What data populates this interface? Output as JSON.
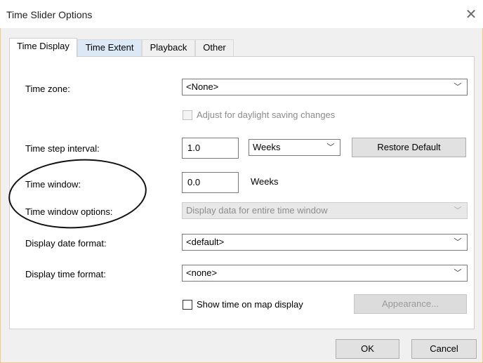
{
  "window": {
    "title": "Time Slider Options"
  },
  "tabs": [
    {
      "label": "Time Display"
    },
    {
      "label": "Time Extent"
    },
    {
      "label": "Playback"
    },
    {
      "label": "Other"
    }
  ],
  "form": {
    "time_zone": {
      "label": "Time zone:",
      "value": "<None>"
    },
    "daylight_saving": {
      "label": "Adjust for daylight saving changes",
      "checked": false,
      "enabled": false
    },
    "time_step_interval": {
      "label": "Time step interval:",
      "value": "1.0",
      "unit": "Weeks",
      "restore_label": "Restore Default"
    },
    "time_window": {
      "label": "Time window:",
      "value": "0.0",
      "unit": "Weeks"
    },
    "time_window_options": {
      "label": "Time window options:",
      "value": "Display data for entire time window",
      "enabled": false
    },
    "display_date_format": {
      "label": "Display date format:",
      "value": "<default>"
    },
    "display_time_format": {
      "label": "Display time format:",
      "value": "<none>"
    },
    "show_time_on_map": {
      "label": "Show time on map display",
      "checked": false
    },
    "appearance_label": "Appearance..."
  },
  "footer": {
    "ok_label": "OK",
    "cancel_label": "Cancel"
  },
  "icons": {
    "close": "close-icon",
    "chevron": "chevron-down-icon"
  }
}
